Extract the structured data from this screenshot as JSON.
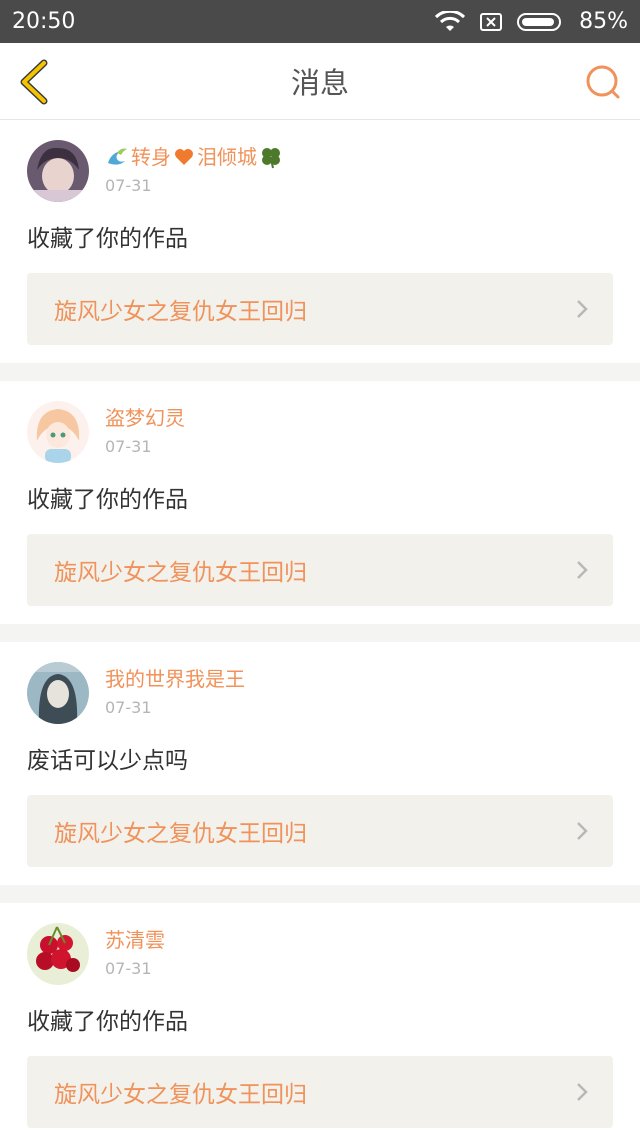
{
  "status_bar": {
    "time": "20:50",
    "battery": "85%"
  },
  "nav": {
    "title": "消息"
  },
  "messages": [
    {
      "username": "转身",
      "username_suffix": "泪倾城",
      "date": "07-31",
      "text": "收藏了你的作品",
      "work": "旋风少女之复仇女王回归"
    },
    {
      "username": "盗梦幻灵",
      "date": "07-31",
      "text": "收藏了你的作品",
      "work": "旋风少女之复仇女王回归"
    },
    {
      "username": "我的世界我是王",
      "date": "07-31",
      "text": "废话可以少点吗",
      "work": "旋风少女之复仇女王回归"
    },
    {
      "username": "苏清雲",
      "date": "07-31",
      "text": "收藏了你的作品",
      "work": "旋风少女之复仇女王回归"
    }
  ],
  "colors": {
    "accent": "#f0925a",
    "back_arrow": "#f5c400",
    "status_bg": "#4a4a4a"
  }
}
